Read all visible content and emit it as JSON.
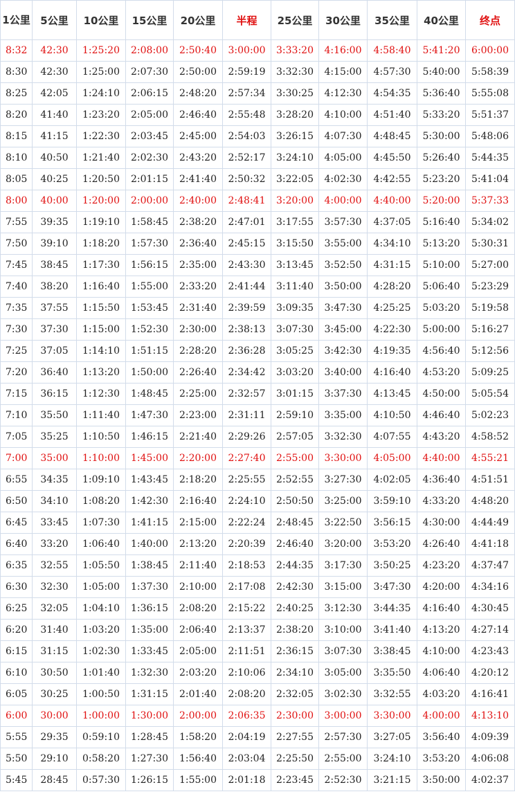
{
  "table": {
    "headers": [
      "1公里",
      "5公里",
      "10公里",
      "15公里",
      "20公里",
      "半程",
      "25公里",
      "30公里",
      "35公里",
      "40公里",
      "终点"
    ],
    "red_headers": [
      5,
      10
    ],
    "rows": [
      {
        "red": true,
        "cells": [
          "8:32",
          "42:30",
          "1:25:20",
          "2:08:00",
          "2:50:40",
          "3:00:00",
          "3:33:20",
          "4:16:00",
          "4:58:40",
          "5:41:20",
          "6:00:00"
        ]
      },
      {
        "red": false,
        "cells": [
          "8:30",
          "42:30",
          "1:25:00",
          "2:07:30",
          "2:50:00",
          "2:59:19",
          "3:32:30",
          "4:15:00",
          "4:57:30",
          "5:40:00",
          "5:58:39"
        ]
      },
      {
        "red": false,
        "cells": [
          "8:25",
          "42:05",
          "1:24:10",
          "2:06:15",
          "2:48:20",
          "2:57:34",
          "3:30:25",
          "4:12:30",
          "4:54:35",
          "5:36:40",
          "5:55:08"
        ]
      },
      {
        "red": false,
        "cells": [
          "8:20",
          "41:40",
          "1:23:20",
          "2:05:00",
          "2:46:40",
          "2:55:48",
          "3:28:20",
          "4:10:00",
          "4:51:40",
          "5:33:20",
          "5:51:37"
        ]
      },
      {
        "red": false,
        "cells": [
          "8:15",
          "41:15",
          "1:22:30",
          "2:03:45",
          "2:45:00",
          "2:54:03",
          "3:26:15",
          "4:07:30",
          "4:48:45",
          "5:30:00",
          "5:48:06"
        ]
      },
      {
        "red": false,
        "cells": [
          "8:10",
          "40:50",
          "1:21:40",
          "2:02:30",
          "2:43:20",
          "2:52:17",
          "3:24:10",
          "4:05:00",
          "4:45:50",
          "5:26:40",
          "5:44:35"
        ]
      },
      {
        "red": false,
        "cells": [
          "8:05",
          "40:25",
          "1:20:50",
          "2:01:15",
          "2:41:40",
          "2:50:32",
          "3:22:05",
          "4:02:30",
          "4:42:55",
          "5:23:20",
          "5:41:04"
        ]
      },
      {
        "red": true,
        "cells": [
          "8:00",
          "40:00",
          "1:20:00",
          "2:00:00",
          "2:40:00",
          "2:48:41",
          "3:20:00",
          "4:00:00",
          "4:40:00",
          "5:20:00",
          "5:37:33"
        ]
      },
      {
        "red": false,
        "cells": [
          "7:55",
          "39:35",
          "1:19:10",
          "1:58:45",
          "2:38:20",
          "2:47:01",
          "3:17:55",
          "3:57:30",
          "4:37:05",
          "5:16:40",
          "5:34:02"
        ]
      },
      {
        "red": false,
        "cells": [
          "7:50",
          "39:10",
          "1:18:20",
          "1:57:30",
          "2:36:40",
          "2:45:15",
          "3:15:50",
          "3:55:00",
          "4:34:10",
          "5:13:20",
          "5:30:31"
        ]
      },
      {
        "red": false,
        "cells": [
          "7:45",
          "38:45",
          "1:17:30",
          "1:56:15",
          "2:35:00",
          "2:43:30",
          "3:13:45",
          "3:52:50",
          "4:31:15",
          "5:10:00",
          "5:27:00"
        ]
      },
      {
        "red": false,
        "cells": [
          "7:40",
          "38:20",
          "1:16:40",
          "1:55:00",
          "2:33:20",
          "2:41:44",
          "3:11:40",
          "3:50:00",
          "4:28:20",
          "5:06:40",
          "5:23:29"
        ]
      },
      {
        "red": false,
        "cells": [
          "7:35",
          "37:55",
          "1:15:50",
          "1:53:45",
          "2:31:40",
          "2:39:59",
          "3:09:35",
          "3:47:30",
          "4:25:25",
          "5:03:20",
          "5:19:58"
        ]
      },
      {
        "red": false,
        "cells": [
          "7:30",
          "37:30",
          "1:15:00",
          "1:52:30",
          "2:30:00",
          "2:38:13",
          "3:07:30",
          "3:45:00",
          "4:22:30",
          "5:00:00",
          "5:16:27"
        ]
      },
      {
        "red": false,
        "cells": [
          "7:25",
          "37:05",
          "1:14:10",
          "1:51:15",
          "2:28:20",
          "2:36:28",
          "3:05:25",
          "3:42:30",
          "4:19:35",
          "4:56:40",
          "5:12:56"
        ]
      },
      {
        "red": false,
        "cells": [
          "7:20",
          "36:40",
          "1:13:20",
          "1:50:00",
          "2:26:40",
          "2:34:42",
          "3:03:20",
          "3:40:00",
          "4:16:40",
          "4:53:20",
          "5:09:25"
        ]
      },
      {
        "red": false,
        "cells": [
          "7:15",
          "36:15",
          "1:12:30",
          "1:48:45",
          "2:25:00",
          "2:32:57",
          "3:01:15",
          "3:37:30",
          "4:13:45",
          "4:50:00",
          "5:05:54"
        ]
      },
      {
        "red": false,
        "cells": [
          "7:10",
          "35:50",
          "1:11:40",
          "1:47:30",
          "2:23:00",
          "2:31:11",
          "2:59:10",
          "3:35:00",
          "4:10:50",
          "4:46:40",
          "5:02:23"
        ]
      },
      {
        "red": false,
        "cells": [
          "7:05",
          "35:25",
          "1:10:50",
          "1:46:15",
          "2:21:40",
          "2:29:26",
          "2:57:05",
          "3:32:30",
          "4:07:55",
          "4:43:20",
          "4:58:52"
        ]
      },
      {
        "red": true,
        "cells": [
          "7:00",
          "35:00",
          "1:10:00",
          "1:45:00",
          "2:20:00",
          "2:27:40",
          "2:55:00",
          "3:30:00",
          "4:05:00",
          "4:40:00",
          "4:55:21"
        ]
      },
      {
        "red": false,
        "cells": [
          "6:55",
          "34:35",
          "1:09:10",
          "1:43:45",
          "2:18:20",
          "2:25:55",
          "2:52:55",
          "3:27:30",
          "4:02:05",
          "4:36:40",
          "4:51:51"
        ]
      },
      {
        "red": false,
        "cells": [
          "6:50",
          "34:10",
          "1:08:20",
          "1:42:30",
          "2:16:40",
          "2:24:10",
          "2:50:50",
          "3:25:00",
          "3:59:10",
          "4:33:20",
          "4:48:20"
        ]
      },
      {
        "red": false,
        "cells": [
          "6:45",
          "33:45",
          "1:07:30",
          "1:41:15",
          "2:15:00",
          "2:22:24",
          "2:48:45",
          "3:22:50",
          "3:56:15",
          "4:30:00",
          "4:44:49"
        ]
      },
      {
        "red": false,
        "cells": [
          "6:40",
          "33:20",
          "1:06:40",
          "1:40:00",
          "2:13:20",
          "2:20:39",
          "2:46:40",
          "3:20:00",
          "3:53:20",
          "4:26:40",
          "4:41:18"
        ]
      },
      {
        "red": false,
        "cells": [
          "6:35",
          "32:55",
          "1:05:50",
          "1:38:45",
          "2:11:40",
          "2:18:53",
          "2:44:35",
          "3:17:30",
          "3:50:25",
          "4:23:20",
          "4:37:47"
        ]
      },
      {
        "red": false,
        "cells": [
          "6:30",
          "32:30",
          "1:05:00",
          "1:37:30",
          "2:10:00",
          "2:17:08",
          "2:42:30",
          "3:15:00",
          "3:47:30",
          "4:20:00",
          "4:34:16"
        ]
      },
      {
        "red": false,
        "cells": [
          "6:25",
          "32:05",
          "1:04:10",
          "1:36:15",
          "2:08:20",
          "2:15:22",
          "2:40:25",
          "3:12:30",
          "3:44:35",
          "4:16:40",
          "4:30:45"
        ]
      },
      {
        "red": false,
        "cells": [
          "6:20",
          "31:40",
          "1:03:20",
          "1:35:00",
          "2:06:40",
          "2:13:37",
          "2:38:20",
          "3:10:00",
          "3:41:40",
          "4:13:20",
          "4:27:14"
        ]
      },
      {
        "red": false,
        "cells": [
          "6:15",
          "31:15",
          "1:02:30",
          "1:33:45",
          "2:05:00",
          "2:11:51",
          "2:36:15",
          "3:07:30",
          "3:38:45",
          "4:10:00",
          "4:23:43"
        ]
      },
      {
        "red": false,
        "cells": [
          "6:10",
          "30:50",
          "1:01:40",
          "1:32:30",
          "2:03:20",
          "2:10:06",
          "2:34:10",
          "3:05:00",
          "3:35:50",
          "4:06:40",
          "4:20:12"
        ]
      },
      {
        "red": false,
        "cells": [
          "6:05",
          "30:25",
          "1:00:50",
          "1:31:15",
          "2:01:40",
          "2:08:20",
          "2:32:05",
          "3:02:30",
          "3:32:55",
          "4:03:20",
          "4:16:41"
        ]
      },
      {
        "red": true,
        "cells": [
          "6:00",
          "30:00",
          "1:00:00",
          "1:30:00",
          "2:00:00",
          "2:06:35",
          "2:30:00",
          "3:00:00",
          "3:30:00",
          "4:00:00",
          "4:13:10"
        ]
      },
      {
        "red": false,
        "cells": [
          "5:55",
          "29:35",
          "0:59:10",
          "1:28:45",
          "1:58:20",
          "2:04:19",
          "2:27:55",
          "2:57:30",
          "3:27:05",
          "3:56:40",
          "4:09:39"
        ]
      },
      {
        "red": false,
        "cells": [
          "5:50",
          "29:10",
          "0:58:20",
          "1:27:30",
          "1:56:40",
          "2:03:04",
          "2:25:50",
          "2:55:00",
          "3:24:10",
          "3:53:20",
          "4:06:08"
        ]
      },
      {
        "red": false,
        "cells": [
          "5:45",
          "28:45",
          "0:57:30",
          "1:26:15",
          "1:55:00",
          "2:01:18",
          "2:23:45",
          "2:52:30",
          "3:21:15",
          "3:50:00",
          "4:02:37"
        ]
      }
    ]
  }
}
